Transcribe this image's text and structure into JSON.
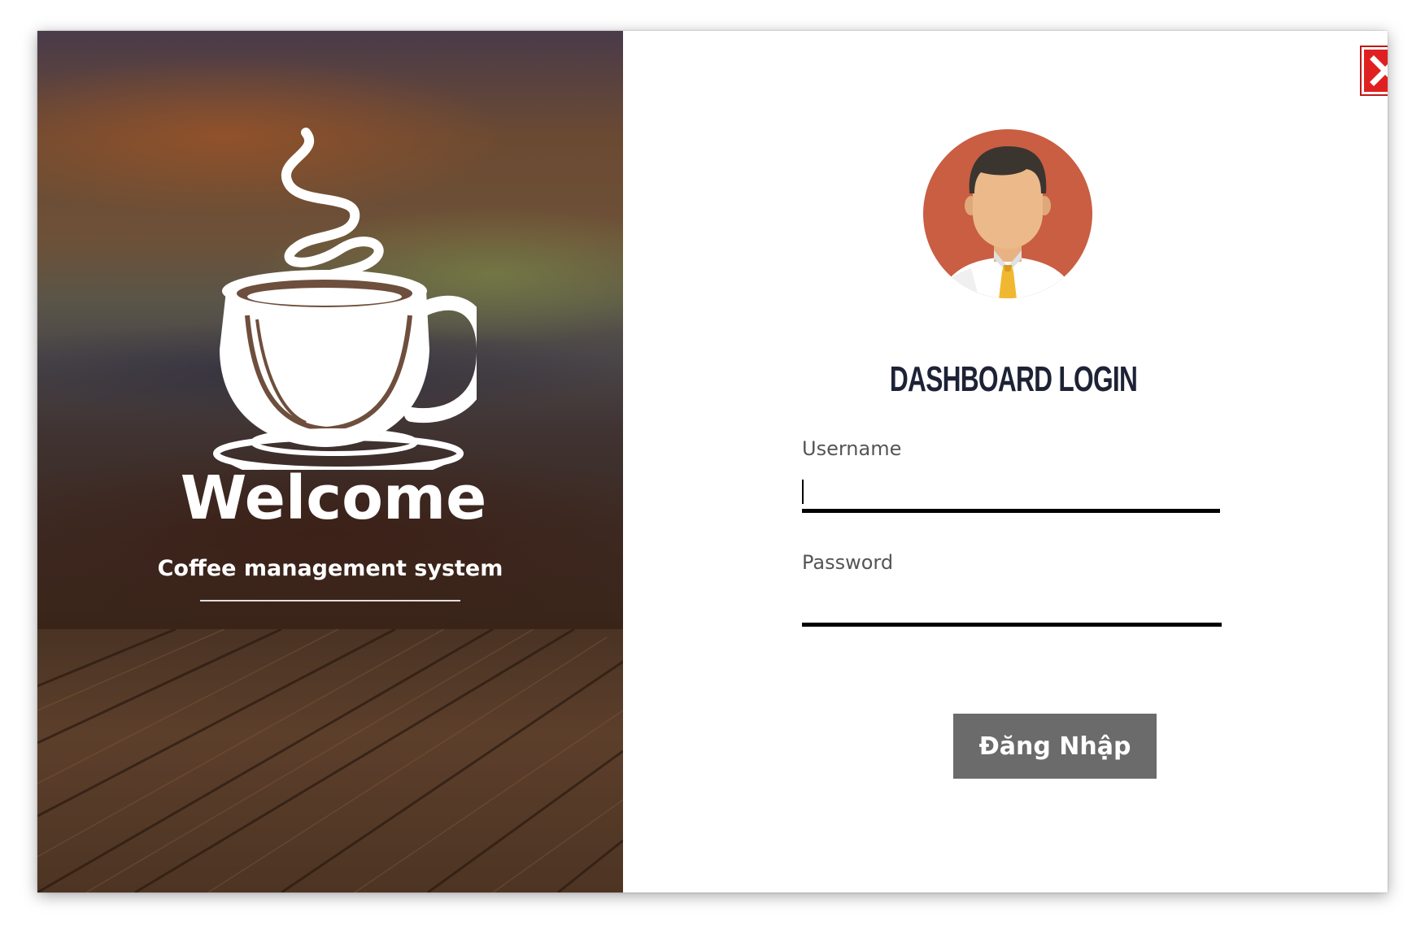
{
  "left_panel": {
    "welcome": "Welcome",
    "subtitle": "Coffee management system"
  },
  "right_panel": {
    "title": "DASHBOARD LOGIN",
    "username_label": "Username",
    "username_value": "",
    "password_label": "Password",
    "password_value": "",
    "login_button": "Đăng Nhập"
  },
  "icons": {
    "close": "close-icon",
    "avatar": "user-avatar-icon",
    "logo": "coffee-cup-icon"
  },
  "colors": {
    "close_button": "#e02020",
    "title_text": "#1d2236",
    "login_button_bg": "#6b6b6b",
    "avatar_bg": "#c95e43"
  }
}
